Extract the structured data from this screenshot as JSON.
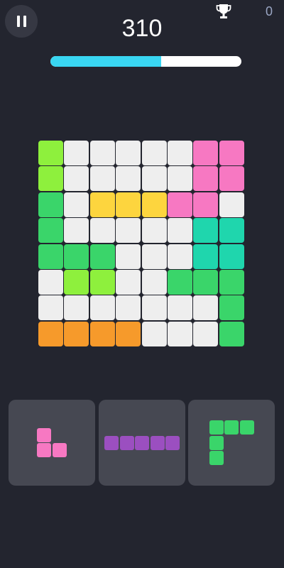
{
  "score": "310",
  "best_score": "0",
  "progress_fraction": 0.58,
  "colors": {
    "E": "#eeeeee",
    "L": "#8ef03d",
    "G": "#3ad56a",
    "Y": "#fdd53e",
    "P": "#f778c2",
    "T": "#1fd6ad",
    "O": "#f69a2b",
    "V": "#9b4fc0",
    "progress_fill": "#39d6f2",
    "background": "#23252f"
  },
  "board": [
    [
      "L",
      "E",
      "E",
      "E",
      "E",
      "E",
      "P",
      "P"
    ],
    [
      "L",
      "E",
      "E",
      "E",
      "E",
      "E",
      "P",
      "P"
    ],
    [
      "G",
      "E",
      "Y",
      "Y",
      "Y",
      "P",
      "P",
      "E"
    ],
    [
      "G",
      "E",
      "E",
      "E",
      "E",
      "E",
      "T",
      "T"
    ],
    [
      "G",
      "G",
      "G",
      "E",
      "E",
      "E",
      "T",
      "T"
    ],
    [
      "E",
      "L",
      "L",
      "E",
      "E",
      "G",
      "G",
      "G"
    ],
    [
      "E",
      "E",
      "E",
      "E",
      "E",
      "E",
      "E",
      "G"
    ],
    [
      "O",
      "O",
      "O",
      "O",
      "E",
      "E",
      "E",
      "G"
    ]
  ],
  "pieces": [
    {
      "color": "P",
      "cells": [
        [
          0,
          0
        ],
        [
          1,
          0
        ],
        [
          1,
          1
        ]
      ]
    },
    {
      "color": "V",
      "cells": [
        [
          0,
          0
        ],
        [
          0,
          1
        ],
        [
          0,
          2
        ],
        [
          0,
          3
        ],
        [
          0,
          4
        ]
      ]
    },
    {
      "color": "G",
      "cells": [
        [
          0,
          0
        ],
        [
          0,
          1
        ],
        [
          0,
          2
        ],
        [
          1,
          0
        ],
        [
          2,
          0
        ]
      ]
    }
  ],
  "icons": {
    "pause": "pause-icon",
    "trophy": "trophy-icon"
  }
}
